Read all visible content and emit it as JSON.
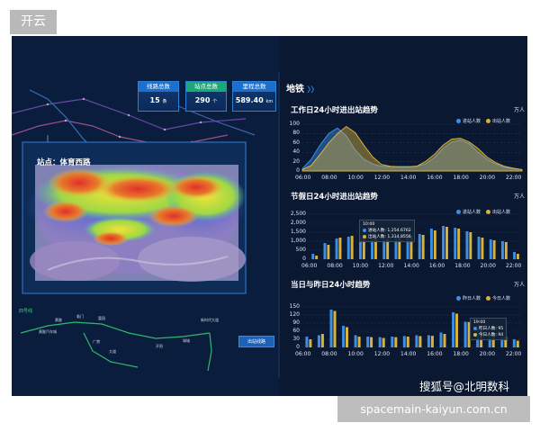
{
  "corner_tag": "开云",
  "source_caption": "spacemain-kaiyun.com.cn",
  "watermark": "搜狐号@北明数科",
  "kpis": [
    {
      "title": "线路总数",
      "value": "15",
      "unit": "条"
    },
    {
      "title": "站点总数",
      "value": "290",
      "unit": "个"
    },
    {
      "title": "里程总数",
      "value": "589.40",
      "unit": "km"
    }
  ],
  "map": {
    "station_title": "站点：体育西路",
    "line_label": "四号线",
    "exit_button": "出站线路",
    "stations": [
      "黄陂汽车城",
      "黄陂",
      "临门",
      "富园",
      "大道",
      "广港",
      "开阳",
      "城城",
      "新时代大道"
    ]
  },
  "right_panel": {
    "title": "地铁",
    "arrows": "〉〉"
  },
  "charts": {
    "weekday": {
      "title": "工作日24小时进出站趋势",
      "unit": "万人",
      "legend": [
        "进站人数",
        "出站人数"
      ],
      "y_ticks": [
        "100",
        "80",
        "60",
        "40",
        "20",
        "0"
      ],
      "x_ticks": [
        "06:00",
        "08:00",
        "10:00",
        "12:00",
        "14:00",
        "16:00",
        "18:00",
        "20:00",
        "22:00"
      ]
    },
    "holiday": {
      "title": "节假日24小时进出站趋势",
      "unit": "万人",
      "legend": [
        "进站人数",
        "出站人数"
      ],
      "y_ticks": [
        "2,500",
        "2,000",
        "1,500",
        "1,000",
        "500",
        "0"
      ],
      "x_ticks": [
        "06:00",
        "08:00",
        "10:00",
        "12:00",
        "14:00",
        "16:00",
        "18:00",
        "20:00",
        "22:00"
      ],
      "tooltip": {
        "time": "10:00",
        "in_label": "进站人数: 1,254.6762",
        "out_label": "出站人数: 1,314.8556"
      }
    },
    "today": {
      "title": "当日与昨日24小时趋势",
      "unit": "万人",
      "legend": [
        "昨日人数",
        "今日人数"
      ],
      "y_ticks": [
        "150",
        "120",
        "90",
        "60",
        "30",
        "0"
      ],
      "x_ticks": [
        "06:00",
        "08:00",
        "10:00",
        "12:00",
        "14:00",
        "16:00",
        "18:00",
        "20:00",
        "22:00"
      ],
      "tooltip": {
        "time": "19:00",
        "yesterday_label": "昨日人数: 95",
        "today_label": "今日人数: 94"
      }
    }
  },
  "chart_data": [
    {
      "type": "area",
      "title": "工作日24小时进出站趋势",
      "ylabel": "万人",
      "ylim": [
        0,
        100
      ],
      "x": [
        "06:00",
        "06:30",
        "07:00",
        "07:30",
        "08:00",
        "08:30",
        "09:00",
        "09:30",
        "10:00",
        "11:00",
        "12:00",
        "13:00",
        "14:00",
        "15:00",
        "16:00",
        "16:30",
        "17:00",
        "17:30",
        "18:00",
        "18:30",
        "19:00",
        "19:30",
        "20:00",
        "21:00",
        "22:00",
        "23:00"
      ],
      "series": [
        {
          "name": "进站人数",
          "color": "#3d8fe6",
          "values": [
            5,
            25,
            55,
            80,
            92,
            75,
            45,
            25,
            15,
            10,
            9,
            9,
            9,
            10,
            15,
            28,
            48,
            62,
            66,
            58,
            40,
            25,
            15,
            8,
            5,
            3
          ]
        },
        {
          "name": "出站人数",
          "color": "#d9b23a",
          "values": [
            3,
            12,
            35,
            60,
            80,
            95,
            82,
            55,
            30,
            14,
            10,
            9,
            9,
            10,
            20,
            35,
            55,
            68,
            70,
            62,
            48,
            30,
            18,
            10,
            6,
            3
          ]
        }
      ],
      "grid": true,
      "legend_position": "top-right"
    },
    {
      "type": "bar",
      "title": "节假日24小时进出站趋势",
      "ylabel": "万人",
      "ylim": [
        0,
        2500
      ],
      "categories": [
        "06:00",
        "07:00",
        "08:00",
        "09:00",
        "10:00",
        "11:00",
        "12:00",
        "13:00",
        "14:00",
        "15:00",
        "16:00",
        "17:00",
        "18:00",
        "19:00",
        "20:00",
        "21:00",
        "22:00",
        "23:00"
      ],
      "series": [
        {
          "name": "进站人数",
          "color": "#3d8fe6",
          "values": [
            300,
            900,
            1150,
            1250,
            1255,
            1150,
            1100,
            1300,
            1250,
            1400,
            1700,
            1850,
            1750,
            1550,
            1250,
            1100,
            1000,
            400
          ]
        },
        {
          "name": "出站人数",
          "color": "#d9b23a",
          "values": [
            200,
            800,
            1200,
            1300,
            1315,
            1200,
            1150,
            1250,
            1300,
            1350,
            1600,
            1800,
            1700,
            1500,
            1200,
            1050,
            950,
            300
          ]
        }
      ],
      "grid": true,
      "legend_position": "top-right"
    },
    {
      "type": "bar",
      "title": "当日与昨日24小时趋势",
      "ylabel": "万人",
      "ylim": [
        0,
        150
      ],
      "categories": [
        "06:00",
        "07:00",
        "08:00",
        "09:00",
        "10:00",
        "11:00",
        "12:00",
        "13:00",
        "14:00",
        "15:00",
        "16:00",
        "17:00",
        "18:00",
        "19:00",
        "20:00",
        "21:00",
        "22:00",
        "23:00"
      ],
      "series": [
        {
          "name": "昨日人数",
          "color": "#3d8fe6",
          "values": [
            40,
            45,
            140,
            80,
            45,
            40,
            38,
            40,
            42,
            45,
            45,
            55,
            130,
            95,
            70,
            55,
            45,
            30
          ]
        },
        {
          "name": "今日人数",
          "color": "#d9b23a",
          "values": [
            30,
            50,
            135,
            75,
            40,
            38,
            35,
            38,
            40,
            42,
            43,
            50,
            125,
            94,
            65,
            50,
            40,
            25
          ]
        }
      ],
      "grid": true,
      "legend_position": "top-right"
    }
  ]
}
